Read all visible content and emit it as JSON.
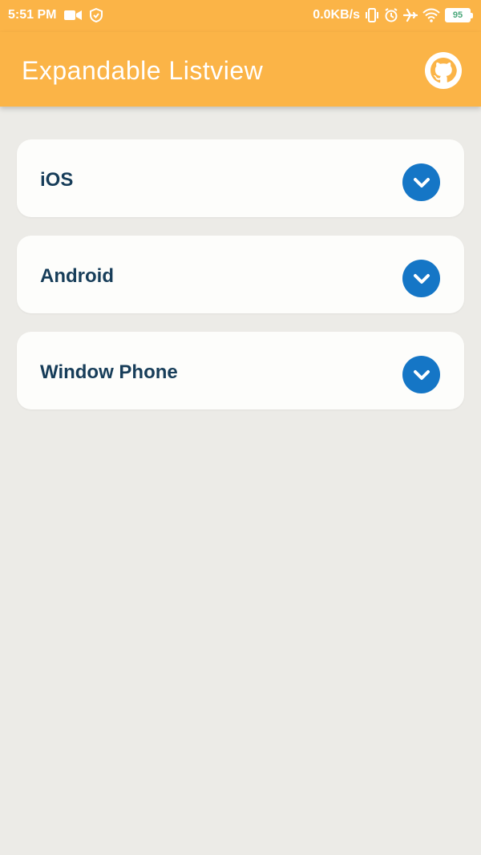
{
  "status_bar": {
    "time": "5:51 PM",
    "network_speed": "0.0KB/s",
    "battery_level": "95",
    "icons": [
      "video-camera-icon",
      "shield-check-icon",
      "vibrate-icon",
      "alarm-icon",
      "airplane-icon",
      "wifi-icon",
      "battery-icon"
    ]
  },
  "app_bar": {
    "title": "Expandable Listview",
    "action_icon": "github-icon",
    "color": "#fbb447"
  },
  "list": {
    "items": [
      {
        "label": "iOS",
        "icon": "chevron-down-icon"
      },
      {
        "label": "Android",
        "icon": "chevron-down-icon"
      },
      {
        "label": "Window Phone",
        "icon": "chevron-down-icon"
      }
    ],
    "accent_color": "#1576c6",
    "label_color": "#173d59"
  },
  "background_color": "#ecebe7"
}
